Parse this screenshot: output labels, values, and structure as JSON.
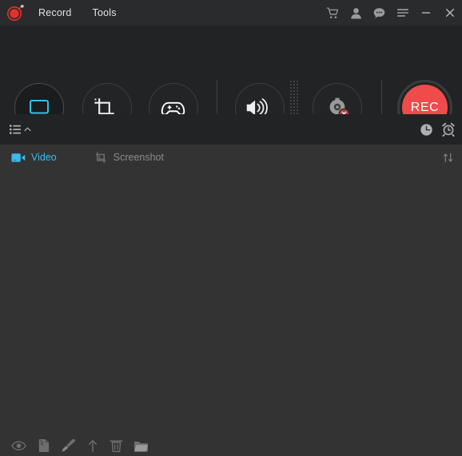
{
  "window": {
    "app_logo": "record-logo-icon",
    "menus": [
      {
        "id": "record",
        "label": "Record"
      },
      {
        "id": "tools",
        "label": "Tools"
      }
    ],
    "controls": [
      {
        "id": "cart",
        "icon": "shopping-cart-icon"
      },
      {
        "id": "account",
        "icon": "user-account-icon"
      },
      {
        "id": "feedback",
        "icon": "chat-bubble-icon"
      },
      {
        "id": "menu",
        "icon": "hamburger-menu-icon"
      },
      {
        "id": "minimize",
        "icon": "minimize-icon"
      },
      {
        "id": "close",
        "icon": "close-icon"
      }
    ]
  },
  "toolbar": {
    "items": [
      {
        "id": "screen",
        "icon": "monitor-screen-icon",
        "state": "active",
        "has_chevron": false
      },
      {
        "id": "region",
        "icon": "crop-region-icon",
        "state": "normal",
        "has_chevron": true
      },
      {
        "id": "game",
        "icon": "gamepad-icon",
        "state": "normal",
        "has_chevron": false
      },
      {
        "id": "audio",
        "icon": "speaker-volume-icon",
        "state": "normal",
        "has_chevron": true
      },
      {
        "id": "webcam",
        "icon": "webcam-disabled-icon",
        "state": "disabled",
        "has_chevron": false
      }
    ],
    "record_button": {
      "label": "REC",
      "icon": "rec-button"
    },
    "drag_handle": "dot-grid-handle"
  },
  "subbar": {
    "list_toggle": {
      "icon": "list-lines-icon",
      "chevron": "chevron-up-icon"
    },
    "right_icons": [
      {
        "id": "history",
        "icon": "clock-history-icon"
      },
      {
        "id": "schedule",
        "icon": "alarm-clock-icon"
      }
    ]
  },
  "tabs": {
    "items": [
      {
        "id": "video",
        "label": "Video",
        "icon": "video-camera-icon",
        "active": true
      },
      {
        "id": "screenshot",
        "label": "Screenshot",
        "icon": "image-picture-icon",
        "active": false
      }
    ],
    "sort": {
      "icon": "sort-updown-icon"
    }
  },
  "content": {
    "items": []
  },
  "bottombar": {
    "icons": [
      {
        "id": "preview",
        "icon": "eye-preview-icon"
      },
      {
        "id": "compress",
        "icon": "compress-file-icon"
      },
      {
        "id": "edit",
        "icon": "brush-edit-icon"
      },
      {
        "id": "share",
        "icon": "upload-share-icon"
      },
      {
        "id": "delete",
        "icon": "trash-delete-icon"
      },
      {
        "id": "folder",
        "icon": "open-folder-icon"
      }
    ]
  },
  "colors": {
    "titlebar_bg": "#2a2b2d",
    "toolbar_bg": "#222325",
    "content_bg": "#333333",
    "accent_cyan": "#37bdeb",
    "rec_red": "#ef4b4b",
    "logo_red": "#e8302a",
    "icon_gray": "#8a8a8a",
    "text_light": "#e2e2e2"
  }
}
